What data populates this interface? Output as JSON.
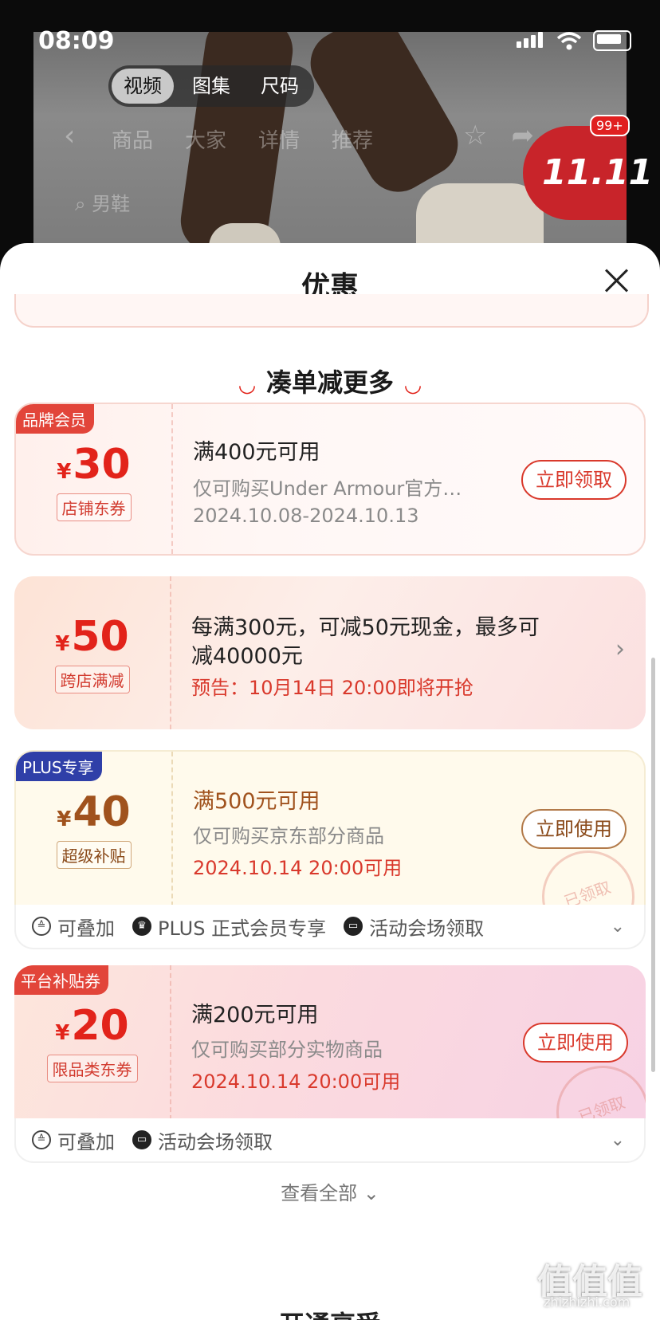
{
  "status_bar": {
    "time": "08:09"
  },
  "media_tabs": [
    {
      "label": "视频",
      "active": true
    },
    {
      "label": "图集",
      "active": false
    },
    {
      "label": "尺码",
      "active": false
    }
  ],
  "background_nav": {
    "tabs": [
      "商品",
      "大家",
      "详情",
      "推荐"
    ],
    "search_text": "男鞋",
    "badge_1111": "11.11",
    "badge_count": "99+"
  },
  "sheet": {
    "title": "优惠",
    "section_title": "凑单减更多",
    "view_all": "查看全部",
    "next_section_title": "开通享受"
  },
  "coupons": [
    {
      "corner_tag": "品牌会员",
      "currency": "¥",
      "amount": "30",
      "type": "店铺东券",
      "line1": "满400元可用",
      "line2": "仅可购买Under Armour官方…",
      "line3": "2024.10.08-2024.10.13",
      "action": "立即领取"
    },
    {
      "currency": "¥",
      "amount": "50",
      "type": "跨店满减",
      "line1": "每满300元，可减50元现金，最多可",
      "line1b": "减40000元",
      "line3": "预告：10月14日 20:00即将开抢"
    },
    {
      "corner_tag": "PLUS专享",
      "currency": "¥",
      "amount": "40",
      "type": "超级补贴",
      "line1": "满500元可用",
      "line2": "仅可购买京东部分商品",
      "line3": "2024.10.14 20:00可用",
      "action": "立即使用",
      "stamp": "已领取",
      "tags": [
        "可叠加",
        "PLUS 正式会员专享",
        "活动会场领取"
      ]
    },
    {
      "corner_tag": "平台补贴券",
      "currency": "¥",
      "amount": "20",
      "type": "限品类东券",
      "line1": "满200元可用",
      "line2": "仅可购买部分实物商品",
      "line3": "2024.10.14 20:00可用",
      "action": "立即使用",
      "stamp": "已领取",
      "tags": [
        "可叠加",
        "活动会场领取"
      ]
    }
  ],
  "watermark": {
    "text": "值值值",
    "sub": "zhizhizhi.com"
  },
  "colors": {
    "accent": "#e2231a",
    "plus_blue": "#2f3fa8",
    "gold": "#a0521d"
  }
}
